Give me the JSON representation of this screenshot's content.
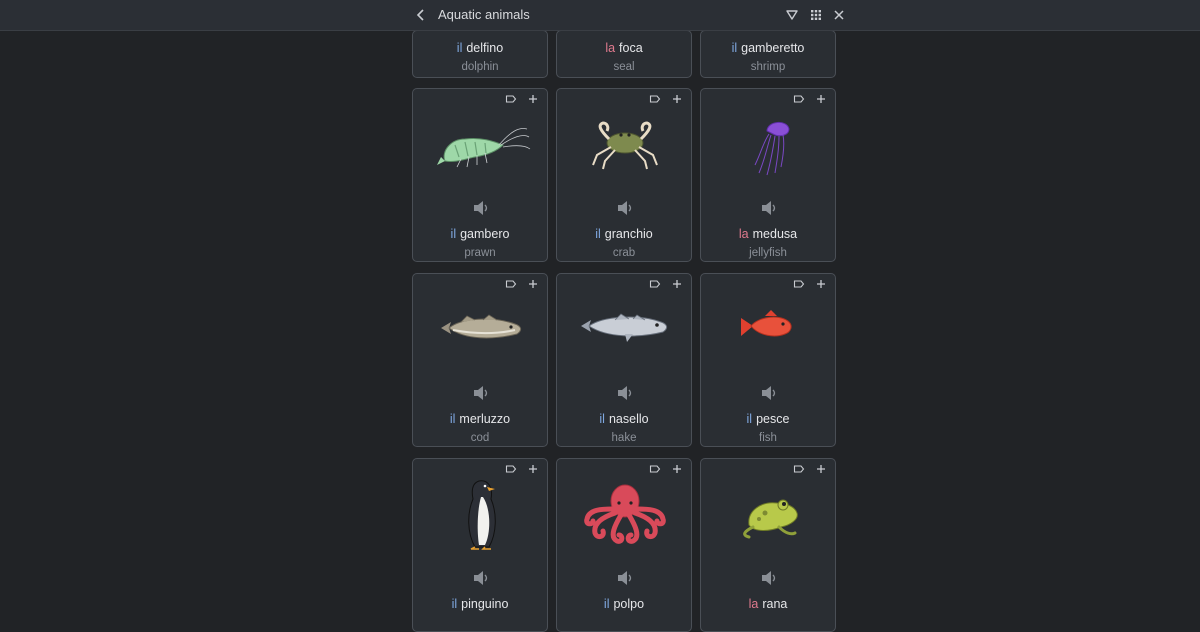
{
  "header": {
    "title": "Aquatic animals",
    "icons": [
      "back-chevron-icon",
      "filter-icon",
      "grid-view-icon",
      "close-icon"
    ]
  },
  "card_icons": [
    "tag-icon",
    "plus-icon",
    "speaker-icon"
  ],
  "article_colors": {
    "masculine": "#7fa8e0",
    "feminine": "#e07a8e"
  },
  "partial_row": [
    {
      "article": "il",
      "gender": "m",
      "word": "delfino",
      "translation": "dolphin"
    },
    {
      "article": "la",
      "gender": "f",
      "word": "foca",
      "translation": "seal"
    },
    {
      "article": "il",
      "gender": "m",
      "word": "gamberetto",
      "translation": "shrimp"
    }
  ],
  "cards": [
    {
      "article": "il",
      "gender": "m",
      "word": "gambero",
      "translation": "prawn",
      "image": "prawn-illustration"
    },
    {
      "article": "il",
      "gender": "m",
      "word": "granchio",
      "translation": "crab",
      "image": "crab-illustration"
    },
    {
      "article": "la",
      "gender": "f",
      "word": "medusa",
      "translation": "jellyfish",
      "image": "jellyfish-illustration"
    },
    {
      "article": "il",
      "gender": "m",
      "word": "merluzzo",
      "translation": "cod",
      "image": "cod-illustration"
    },
    {
      "article": "il",
      "gender": "m",
      "word": "nasello",
      "translation": "hake",
      "image": "hake-illustration"
    },
    {
      "article": "il",
      "gender": "m",
      "word": "pesce",
      "translation": "fish",
      "image": "fish-illustration"
    },
    {
      "article": "il",
      "gender": "m",
      "word": "pinguino",
      "translation": "",
      "image": "penguin-illustration"
    },
    {
      "article": "il",
      "gender": "m",
      "word": "polpo",
      "translation": "",
      "image": "octopus-illustration"
    },
    {
      "article": "la",
      "gender": "f",
      "word": "rana",
      "translation": "",
      "image": "frog-illustration"
    }
  ]
}
